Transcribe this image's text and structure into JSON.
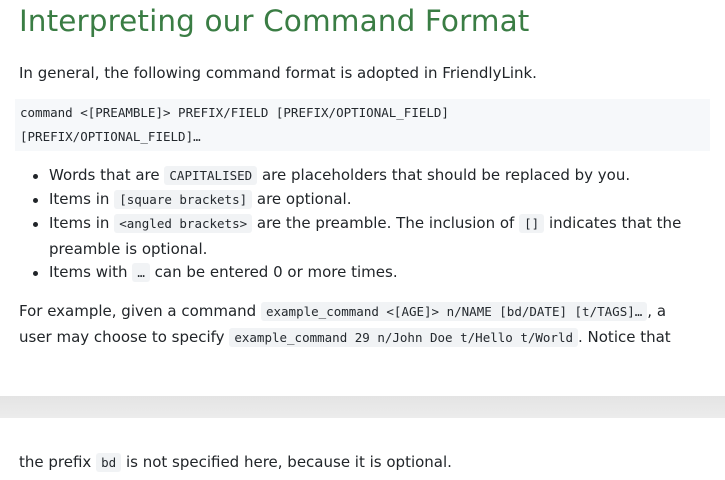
{
  "heading": "Interpreting our Command Format",
  "intro": "In general, the following command format is adopted in FriendlyLink.",
  "format_line1": "command <[PREAMBLE]> PREFIX/FIELD [PREFIX/OPTIONAL_FIELD]",
  "format_line2": "[PREFIX/OPTIONAL_FIELD]…",
  "bullets": [
    {
      "before": "Words that are",
      "code": "CAPITALISED",
      "after": "are placeholders that should be replaced by you."
    },
    {
      "before": "Items in",
      "code": "[square brackets]",
      "after": "are optional."
    },
    {
      "before": "Items in",
      "code": "<angled brackets>",
      "after": "are the preamble. The inclusion of",
      "code2": "[]",
      "after2": "indicates that the",
      "cont": "preamble is optional."
    },
    {
      "before": "Items with",
      "code": "…",
      "after": "can be entered 0 or more times."
    }
  ],
  "example": {
    "line1_before": "For example, given a command",
    "line1_code": "example_command <[AGE]> n/NAME [bd/DATE] [t/TAGS]…",
    "line1_after": ", a",
    "line2_before": "user may choose to specify",
    "line2_code": "example_command 29 n/John Doe t/Hello t/World",
    "line2_after": ". Notice that"
  },
  "continuation": {
    "before": "the prefix",
    "code": "bd",
    "after": "is not specified here, because it is optional."
  }
}
